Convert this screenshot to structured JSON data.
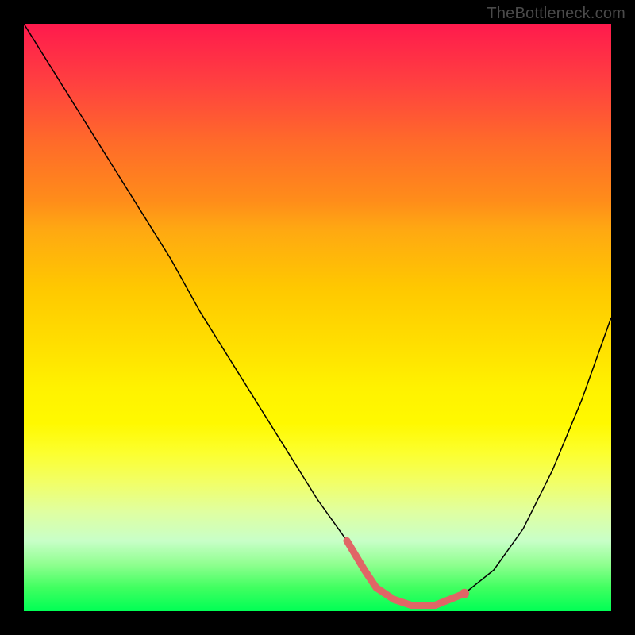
{
  "watermark": "TheBottleneck.com",
  "chart_data": {
    "type": "line",
    "title": "",
    "xlabel": "",
    "ylabel": "",
    "xlim": [
      0,
      100
    ],
    "ylim": [
      0,
      100
    ],
    "grid": false,
    "legend": false,
    "background_gradient": {
      "top": "#ff1a4d",
      "bottom": "#00ff55",
      "meaning": "red = high bottleneck, green = low bottleneck"
    },
    "series": [
      {
        "name": "bottleneck-curve",
        "x": [
          0,
          5,
          10,
          15,
          20,
          25,
          30,
          35,
          40,
          45,
          50,
          55,
          58,
          60,
          63,
          66,
          70,
          75,
          80,
          85,
          90,
          95,
          100
        ],
        "y": [
          100,
          92,
          84,
          76,
          68,
          60,
          51,
          43,
          35,
          27,
          19,
          12,
          7,
          4,
          2,
          1,
          1,
          3,
          7,
          14,
          24,
          36,
          50
        ]
      }
    ],
    "markers": {
      "name": "trough-highlight",
      "color": "#e06666",
      "x": [
        55,
        58,
        60,
        63,
        66,
        70,
        75
      ],
      "y": [
        12,
        7,
        4,
        2,
        1,
        1,
        3
      ],
      "end_dot": {
        "x": 75,
        "y": 3
      }
    }
  }
}
